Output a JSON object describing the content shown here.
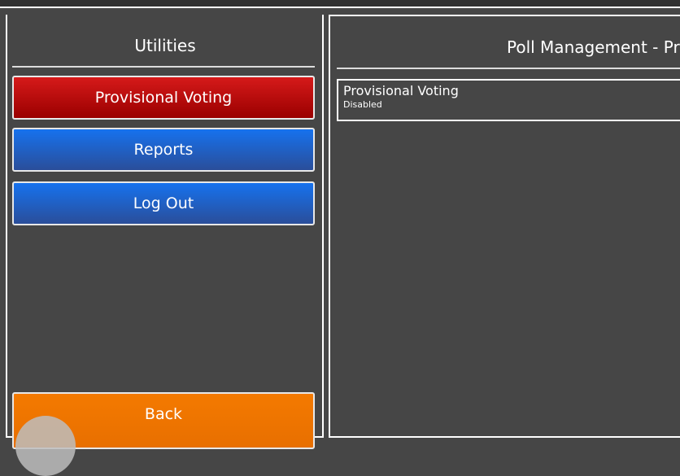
{
  "utilities": {
    "title": "Utilities",
    "buttons": {
      "provisional_voting": "Provisional Voting",
      "reports": "Reports",
      "log_out": "Log Out",
      "back": "Back"
    }
  },
  "main": {
    "title": "Poll Management - Pro",
    "settings": [
      {
        "name": "Provisional Voting",
        "status": "Disabled"
      }
    ]
  },
  "colors": {
    "background": "#464646",
    "active_button": "#c40f0f",
    "nav_button": "#1a6ae0",
    "back_button": "#f27600"
  }
}
